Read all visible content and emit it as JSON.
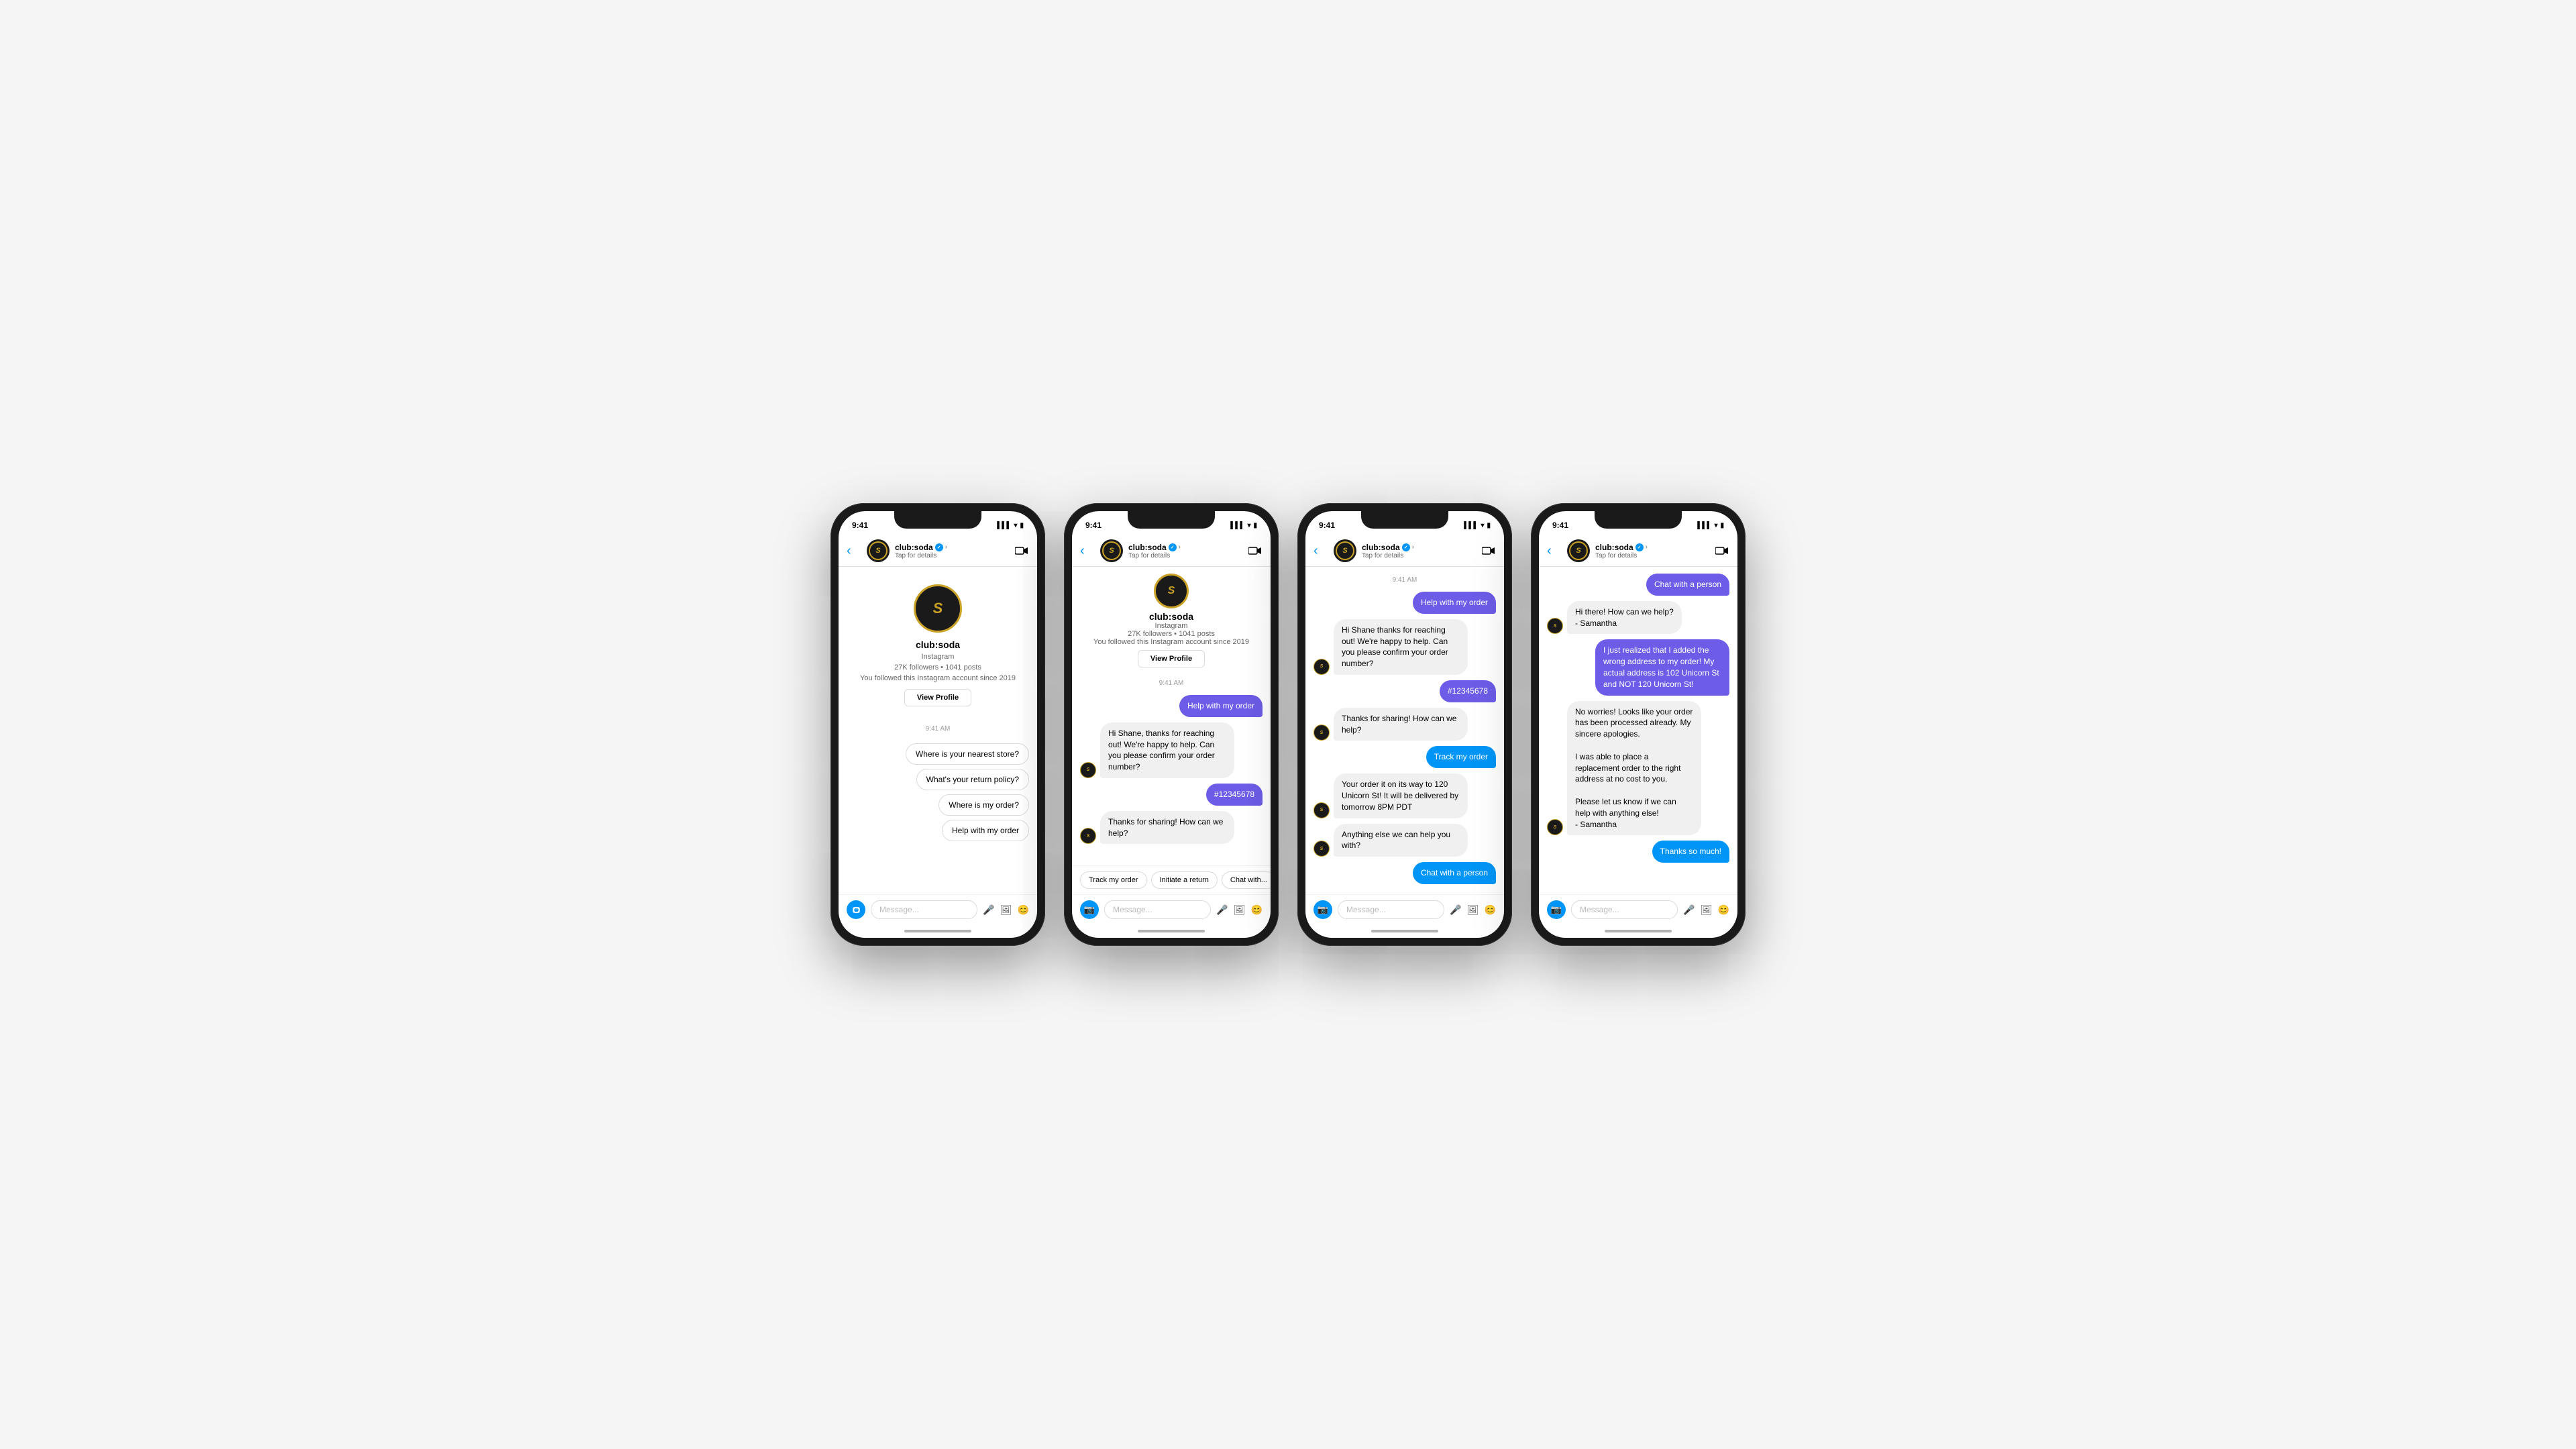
{
  "phones": [
    {
      "id": "phone1",
      "time": "9:41",
      "profile": {
        "name": "club:soda",
        "platform": "Instagram",
        "stats": "27K followers • 1041 posts",
        "followed": "You followed this Instagram account since 2019",
        "view_profile_label": "View Profile"
      },
      "timestamp": "9:41 AM",
      "tap_for_details": "Tap for details",
      "quick_replies": [
        "Where is your nearest store?",
        "What's your return policy?",
        "Where is my order?",
        "Help with my order"
      ],
      "input_placeholder": "Message..."
    },
    {
      "id": "phone2",
      "time": "9:41",
      "tap_for_details": "Tap for details",
      "timestamp": "9:41 AM",
      "messages": [
        {
          "type": "sent",
          "color": "purple",
          "text": "Help with my order"
        },
        {
          "type": "received",
          "text": "Hi Shane, thanks for reaching out! We're happy to help. Can you please confirm your order number?"
        },
        {
          "type": "sent",
          "color": "purple",
          "text": "#12345678"
        },
        {
          "type": "received",
          "text": "Thanks for sharing! How can we help?"
        }
      ],
      "chips": [
        "Track my order",
        "Initiate a return",
        "Chat with..."
      ],
      "input_placeholder": "Message..."
    },
    {
      "id": "phone3",
      "time": "9:41",
      "tap_for_details": "Tap for details",
      "timestamp": "9:41 AM",
      "messages": [
        {
          "type": "sent",
          "color": "purple",
          "text": "Help with my order"
        },
        {
          "type": "received",
          "text": "Hi Shane thanks for reaching out! We're happy to help. Can you please confirm your order number?"
        },
        {
          "type": "sent",
          "color": "purple",
          "text": "#12345678"
        },
        {
          "type": "received",
          "text": "Thanks for sharing! How can we help?"
        },
        {
          "type": "sent",
          "color": "blue",
          "text": "Track my order"
        },
        {
          "type": "received",
          "text": "Your order it on its way to 120 Unicorn St! It will be delivered by tomorrow 8PM PDT"
        },
        {
          "type": "received",
          "text": "Anything else we can help you with?"
        },
        {
          "type": "sent",
          "color": "blue",
          "text": "Chat with a person"
        }
      ],
      "input_placeholder": "Message..."
    },
    {
      "id": "phone4",
      "time": "9:41",
      "tap_for_details": "Tap for details",
      "messages": [
        {
          "type": "sent",
          "color": "purple",
          "text": "Chat with a person"
        },
        {
          "type": "received",
          "text": "Hi there! How can we help?\n- Samantha"
        },
        {
          "type": "sent",
          "color": "purple",
          "text": "I just realized that I added the wrong address to my order! My actual address is 102 Unicorn St and NOT 120 Unicorn St!"
        },
        {
          "type": "received",
          "text": "No worries! Looks like your order has been processed already. My sincere apologies.\n\nI was able to place a replacement order to the right address at no cost to you.\n\nPlease let us know if we can help with anything else!\n- Samantha"
        },
        {
          "type": "sent",
          "color": "blue",
          "text": "Thanks so much!"
        }
      ],
      "input_placeholder": "Message..."
    }
  ],
  "brand": {
    "name": "club:soda",
    "verified": true,
    "symbol": "S"
  },
  "colors": {
    "purple_bubble": "#6c5ce7",
    "blue_bubble": "#0095f6",
    "received_bubble": "#f0f0f0",
    "instagram_blue": "#0095f6"
  }
}
